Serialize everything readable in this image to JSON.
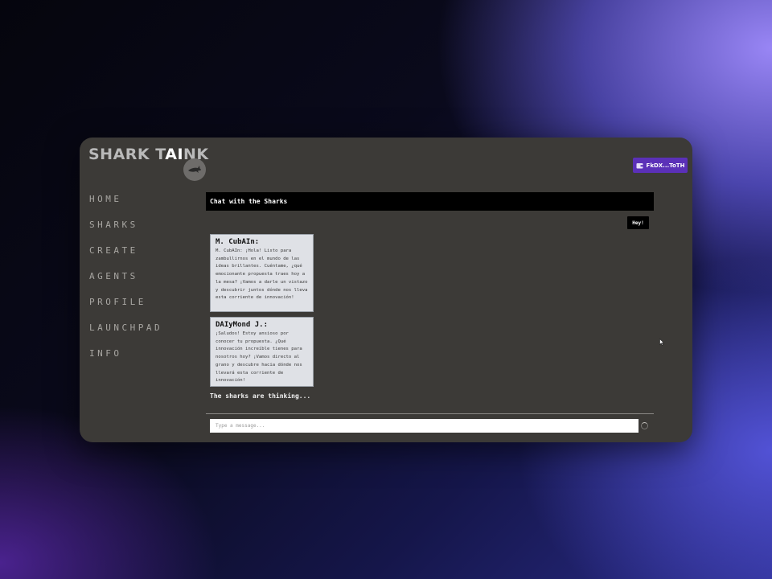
{
  "app": {
    "logo_prefix": "SHARK T",
    "logo_ai": "AI",
    "logo_suffix": "NK"
  },
  "header": {
    "wallet_label": "FkDX...ToTH"
  },
  "nav": {
    "items": [
      "HOME",
      "SHARKS",
      "CREATE",
      "AGENTS",
      "PROFILE",
      "LAUNCHPAD",
      "INFO"
    ]
  },
  "chat": {
    "title": "Chat with the Sharks",
    "user_message": "Hey!",
    "messages": [
      {
        "name": "M. CubAIn:",
        "text": "M. CubAIn: ¡Hola! Listo para zambullirnos en el mundo de las ideas brillantes. Cuéntame, ¿qué emocionante propuesta traes hoy a la mesa? ¡Vamos a darle un vistazo y descubrir juntos dónde nos lleva esta corriente de innovación!"
      },
      {
        "name": "DAIyMond J.:",
        "text": "¡Saludos! Estoy ansioso por conocer tu propuesta. ¿Qué innovación increíble tienes para nosotros hoy? ¡Vamos directo al grano y descubre hacia dónde nos llevará esta corriente de innovación!"
      }
    ],
    "status": "The sharks are thinking...",
    "input_placeholder": "Type a message..."
  },
  "icons": {
    "shark_button": "shark-icon",
    "wallet": "wallet-icon",
    "loading": "spinner-icon",
    "cursor": "mouse-cursor-icon"
  },
  "colors": {
    "window_bg": "#3c3a37",
    "accent": "#5b30b8",
    "card_bg": "#dfe1e6"
  }
}
